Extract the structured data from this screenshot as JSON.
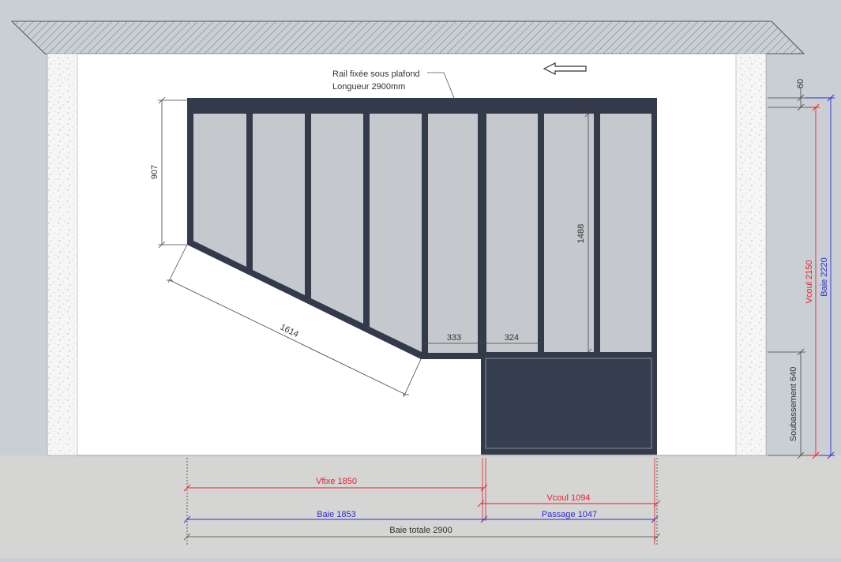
{
  "labels": {
    "rail_line1": "Rail fixée sous plafond",
    "rail_line2": "Longueur 2900mm",
    "dim_907": "907",
    "dim_1614": "1614",
    "dim_1488": "1488",
    "dim_333": "333",
    "dim_324": "324",
    "dim_60": "60",
    "vcoul_2150": "Vcoul 2150",
    "baie_2220": "Baie 2220",
    "soubassement_640": "Soubassement 640",
    "vfixe_1850": "Vfixe 1850",
    "vcoul_1094": "Vcoul 1094",
    "baie_1853": "Baie 1853",
    "passage_1047": "Passage 1047",
    "baie_totale_2900": "Baie totale 2900"
  },
  "colors": {
    "background": "#c9cfd3",
    "floor": "#d5d5d3",
    "wall": "#ffffff",
    "frame": "#333b4b",
    "glass": "#c5c8cc",
    "panel": "#333b4b",
    "dim_black": "#444444",
    "dim_red": "#e8202a",
    "dim_blue": "#2b2bd6"
  },
  "icons": {
    "direction_arrow": "arrow-left-icon"
  }
}
